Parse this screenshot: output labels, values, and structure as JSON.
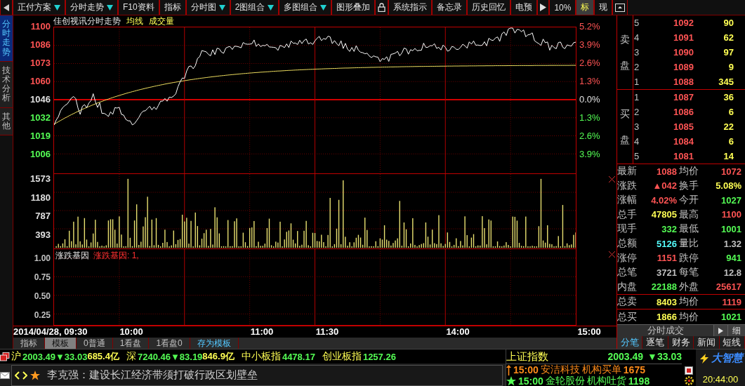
{
  "toolbar": [
    {
      "kind": "back"
    },
    {
      "kind": "dropdown",
      "label": "正付方案",
      "selected": false
    },
    {
      "kind": "dropdown",
      "label": "分时走势",
      "selected": false
    },
    {
      "kind": "button",
      "label": "F10资料",
      "selected": false
    },
    {
      "kind": "button",
      "label": "指标",
      "selected": false
    },
    {
      "kind": "dropdown",
      "label": "分时图",
      "selected": false
    },
    {
      "kind": "dropdown",
      "label": "2图组合",
      "selected": false
    },
    {
      "kind": "dropdown",
      "label": "多图组合",
      "selected": false
    },
    {
      "kind": "button",
      "label": "图形叠加",
      "selected": false
    },
    {
      "kind": "lock"
    },
    {
      "kind": "button",
      "label": "系统指示",
      "selected": false
    },
    {
      "kind": "button",
      "label": "备忘录",
      "selected": false
    },
    {
      "kind": "button",
      "label": "历史回忆",
      "selected": false
    },
    {
      "kind": "button",
      "label": "电预",
      "selected": false
    },
    {
      "kind": "play"
    },
    {
      "kind": "button",
      "label": "10%",
      "selected": false
    },
    {
      "kind": "button",
      "label": "标",
      "selected": true
    },
    {
      "kind": "button",
      "label": "现",
      "selected": false
    },
    {
      "kind": "window"
    }
  ],
  "side_tabs": [
    {
      "label": "分时走势",
      "selected": true
    },
    {
      "label": "技术分析",
      "selected": false
    },
    {
      "label": "其他",
      "selected": false
    }
  ],
  "chart": {
    "title": "佳创视讯分时走势",
    "legends": [
      "均线",
      "成交量"
    ],
    "price_levels": [
      {
        "price": "1100",
        "percent": "5.2%",
        "kind": "up"
      },
      {
        "price": "1086",
        "percent": "3.9%",
        "kind": "up"
      },
      {
        "price": "1073",
        "percent": "2.6%",
        "kind": "up"
      },
      {
        "price": "1060",
        "percent": "1.3%",
        "kind": "up"
      },
      {
        "price": "1046",
        "percent": "0.0%",
        "kind": "flat"
      },
      {
        "price": "1032",
        "percent": "1.3%",
        "kind": "down"
      },
      {
        "price": "1019",
        "percent": "2.6%",
        "kind": "down"
      },
      {
        "price": "1006",
        "percent": "3.9%",
        "kind": "down"
      }
    ],
    "volume_levels": [
      "1573",
      "1180",
      "787",
      "393"
    ],
    "indicator": {
      "name": "涨跌基因",
      "reading": "涨跌基因: 1,",
      "levels": [
        "1.00",
        "0.75",
        "0.50",
        "0.25"
      ]
    },
    "times": [
      "2014/04/28, 09:30",
      "10:00",
      "11:00",
      "11:30",
      "14:00",
      "15:00"
    ]
  },
  "templates": [
    {
      "label": "指标",
      "selected": false,
      "kind": "tab"
    },
    {
      "label": "模板",
      "selected": true,
      "kind": "tab"
    },
    {
      "label": "0普通",
      "selected": false,
      "kind": "tab"
    },
    {
      "label": "1看盘",
      "selected": false,
      "kind": "tab"
    },
    {
      "label": "1看盘0",
      "selected": false,
      "kind": "tab"
    },
    {
      "label": "存为模板",
      "selected": false,
      "kind": "action"
    }
  ],
  "order_book": {
    "sell_label": "卖盘",
    "buy_label": "买盘",
    "sell": [
      {
        "level": "5",
        "price": "1092",
        "volume": "90"
      },
      {
        "level": "4",
        "price": "1091",
        "volume": "62"
      },
      {
        "level": "3",
        "price": "1090",
        "volume": "97"
      },
      {
        "level": "2",
        "price": "1089",
        "volume": "9"
      },
      {
        "level": "1",
        "price": "1088",
        "volume": "345"
      }
    ],
    "buy": [
      {
        "level": "1",
        "price": "1087",
        "volume": "36"
      },
      {
        "level": "2",
        "price": "1086",
        "volume": "6"
      },
      {
        "level": "3",
        "price": "1085",
        "volume": "22"
      },
      {
        "level": "4",
        "price": "1084",
        "volume": "6"
      },
      {
        "level": "5",
        "price": "1081",
        "volume": "14"
      }
    ]
  },
  "stats": [
    {
      "cells": [
        {
          "label": "最新",
          "value": "1088",
          "color": "#ff5454"
        },
        {
          "label": "均价",
          "value": "1072",
          "color": "#ff5454"
        }
      ]
    },
    {
      "cells": [
        {
          "label": "涨跌",
          "value": "▲042",
          "color": "#ff5454"
        },
        {
          "label": "换手",
          "value": "5.08%",
          "color": "#ffff54"
        }
      ]
    },
    {
      "cells": [
        {
          "label": "涨幅",
          "value": "4.02%",
          "color": "#ff5454"
        },
        {
          "label": "今开",
          "value": "1027",
          "color": "#54fc54"
        }
      ]
    },
    {
      "cells": [
        {
          "label": "总手",
          "value": "47805",
          "color": "#ffff54"
        },
        {
          "label": "最高",
          "value": "1100",
          "color": "#ff5454"
        }
      ]
    },
    {
      "cells": [
        {
          "label": "现手",
          "value": "332",
          "color": "#54fc54"
        },
        {
          "label": "最低",
          "value": "1001",
          "color": "#54fc54"
        }
      ]
    },
    {
      "cells": [
        {
          "label": "总额",
          "value": "5126",
          "color": "#54fcfc"
        },
        {
          "label": "量比",
          "value": "1.32",
          "color": "#c0c0c0"
        }
      ]
    },
    {
      "cells": [
        {
          "label": "涨停",
          "value": "1151",
          "color": "#ff5454"
        },
        {
          "label": "跌停",
          "value": "941",
          "color": "#54fc54"
        }
      ]
    },
    {
      "cells": [
        {
          "label": "总笔",
          "value": "3721",
          "color": "#c0c0c0"
        },
        {
          "label": "每笔",
          "value": "12.8",
          "color": "#c0c0c0"
        }
      ]
    },
    {
      "cells": [
        {
          "label": "内盘",
          "value": "22188",
          "color": "#54fc54"
        },
        {
          "label": "外盘",
          "value": "25617",
          "color": "#ff5454"
        }
      ]
    }
  ],
  "totals": [
    {
      "cells": [
        {
          "label": "总卖",
          "value": "8403",
          "color": "#ffff54"
        },
        {
          "label": "均价",
          "value": "1119",
          "color": "#ff5454"
        }
      ]
    },
    {
      "cells": [
        {
          "label": "总买",
          "value": "1866",
          "color": "#ffff54"
        },
        {
          "label": "均价",
          "value": "1021",
          "color": "#54fc54"
        }
      ]
    }
  ],
  "trade_detail": {
    "label": "分时成交",
    "button": "细"
  },
  "detail_tabs": [
    {
      "label": "分笔",
      "selected": true
    },
    {
      "label": "逐笔",
      "selected": false
    },
    {
      "label": "财务",
      "selected": false
    },
    {
      "label": "新闻",
      "selected": false
    },
    {
      "label": "短线",
      "selected": false
    }
  ],
  "ticker": [
    {
      "label": "沪",
      "value": "2003.49",
      "change": "▼33.03",
      "amount": "685.4亿"
    },
    {
      "label": "深",
      "value": "7240.46",
      "change": "▼83.19",
      "amount": "846.9亿"
    },
    {
      "label": "中小板指",
      "value": "4478.17"
    },
    {
      "label": "创业板指",
      "value": "1257.26"
    }
  ],
  "index_quote": {
    "label": "上证指数",
    "value": "2003.49",
    "change": "▼33.03"
  },
  "news": {
    "text": "李克强：建设长江经济带须打破行政区划壁垒"
  },
  "alerts": [
    {
      "time": "15:00",
      "stock": "安洁科技",
      "event": "机构买单",
      "value": "1675",
      "kind": "buy"
    },
    {
      "time": "15:00",
      "stock": "金轮股份",
      "event": "机构吐货",
      "value": "1198",
      "kind": "sell"
    }
  ],
  "brand": "大智慧",
  "clock": "20:44:00"
}
